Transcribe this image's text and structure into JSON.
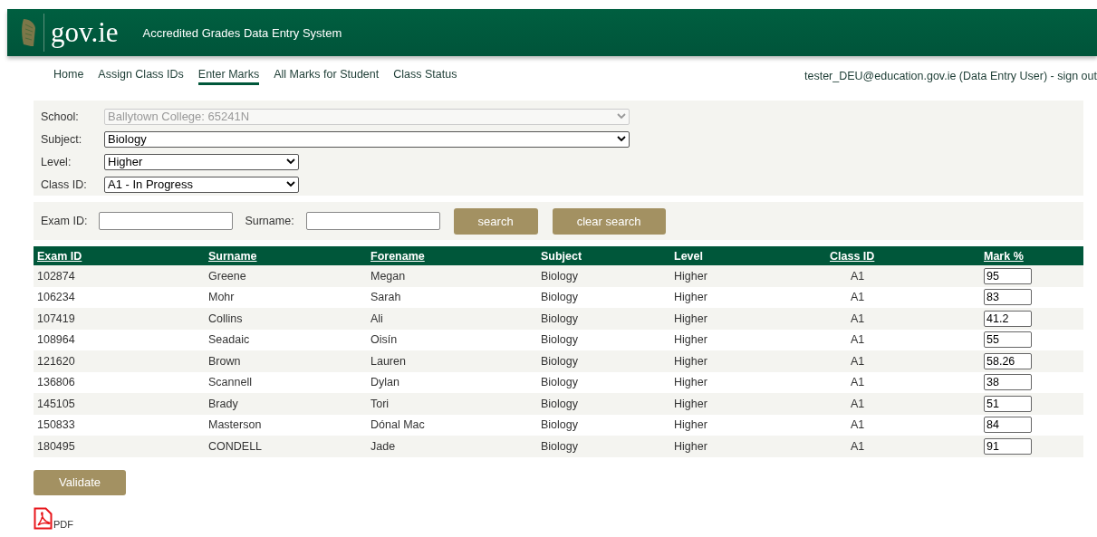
{
  "header": {
    "logo": "gov.ie",
    "title": "Accredited Grades Data Entry System"
  },
  "nav": [
    {
      "label": "Home",
      "selected": false
    },
    {
      "label": "Assign Class IDs",
      "selected": false
    },
    {
      "label": "Enter Marks",
      "selected": true
    },
    {
      "label": "All Marks for Student",
      "selected": false
    },
    {
      "label": "Class Status",
      "selected": false
    }
  ],
  "user": "tester_DEU@education.gov.ie (Data Entry User) - sign out",
  "filters": [
    {
      "label": "School:",
      "value": "Ballytown College: 65241N",
      "disabled": true
    },
    {
      "label": "Subject:",
      "value": "Biology",
      "disabled": false
    },
    {
      "label": "Level:",
      "value": "Higher",
      "disabled": false
    },
    {
      "label": "Class ID:",
      "value": "A1 - In Progress",
      "disabled": false
    }
  ],
  "search": {
    "fields": [
      {
        "label": "Exam ID:"
      },
      {
        "label": "Surname:"
      }
    ],
    "buttons": [
      "search",
      "clear search"
    ]
  },
  "table": {
    "columns": [
      {
        "label": "Exam ID",
        "sortable": true
      },
      {
        "label": "Surname",
        "sortable": true
      },
      {
        "label": "Forename",
        "sortable": true
      },
      {
        "label": "Subject",
        "sortable": false
      },
      {
        "label": "Level",
        "sortable": false
      },
      {
        "label": "Class ID",
        "sortable": true
      },
      {
        "label": "Mark %",
        "sortable": true
      }
    ],
    "rows": [
      [
        "102874",
        "Greene",
        "Megan",
        "Biology",
        "Higher",
        "A1",
        "95"
      ],
      [
        "106234",
        "Mohr",
        "Sarah",
        "Biology",
        "Higher",
        "A1",
        "83"
      ],
      [
        "107419",
        "Collins",
        "Ali",
        "Biology",
        "Higher",
        "A1",
        "41.2"
      ],
      [
        "108964",
        "Seadaic",
        "Oisín",
        "Biology",
        "Higher",
        "A1",
        "55"
      ],
      [
        "121620",
        "Brown",
        "Lauren",
        "Biology",
        "Higher",
        "A1",
        "58.26"
      ],
      [
        "136806",
        "Scannell",
        "Dylan",
        "Biology",
        "Higher",
        "A1",
        "38"
      ],
      [
        "145105",
        "Brady",
        "Tori",
        "Biology",
        "Higher",
        "A1",
        "51"
      ],
      [
        "150833",
        "Masterson",
        "Dónal Mac",
        "Biology",
        "Higher",
        "A1",
        "84"
      ],
      [
        "180495",
        "CONDELL",
        "Jade",
        "Biology",
        "Higher",
        "A1",
        "91"
      ]
    ]
  },
  "validate_button": "Validate",
  "pdf_link": "PDF"
}
